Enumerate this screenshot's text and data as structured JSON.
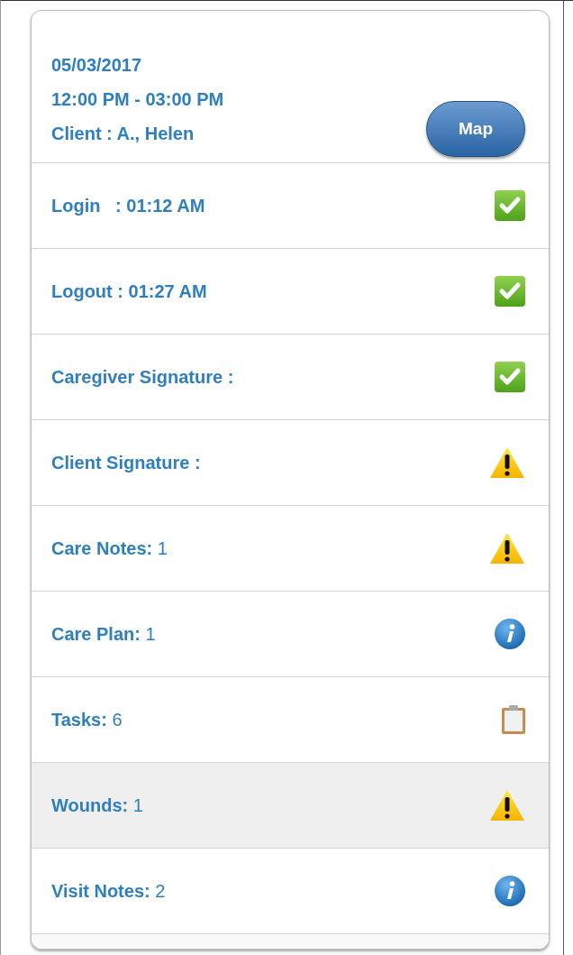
{
  "visit": {
    "date": "05/03/2017",
    "time": "12:00 PM - 03:00 PM",
    "client": "Client : A., Helen",
    "map_button": "Map"
  },
  "items": [
    {
      "label": "**Login   : 01:12 AM**",
      "kind": "check",
      "selected": false
    },
    {
      "label": "**Logout : 01:27 AM**",
      "kind": "check",
      "selected": false
    },
    {
      "label": "**Caregiver Signature :**",
      "kind": "check",
      "selected": false
    },
    {
      "label": "**Client Signature :**",
      "kind": "warning",
      "selected": false
    },
    {
      "label": "**Care Notes:** 1",
      "kind": "warning",
      "selected": false
    },
    {
      "label": "**Care Plan:** 1",
      "kind": "info",
      "selected": false
    },
    {
      "label": "**Tasks:** 6",
      "kind": "clipboard",
      "selected": false
    },
    {
      "label": "**Wounds:** 1",
      "kind": "warning",
      "selected": true
    },
    {
      "label": "**Visit Notes:** 2",
      "kind": "info",
      "selected": false
    }
  ]
}
